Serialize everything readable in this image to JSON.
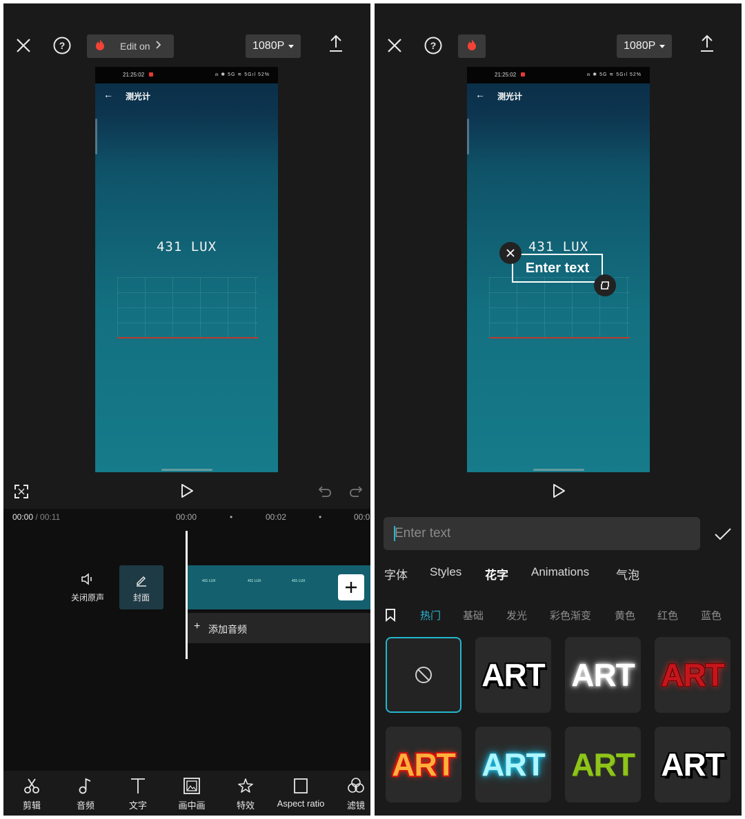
{
  "left": {
    "top": {
      "edit_label": "Edit on",
      "resolution": "1080P"
    },
    "phone": {
      "time": "21:25:02",
      "status_icons": "⍾ ✱ 5G ≋ 5Gıl 52%",
      "title": "测光计",
      "reading": "431 LUX"
    },
    "timeline": {
      "current": "00:00",
      "total": "/ 00:11",
      "tick_0": "00:00",
      "tick_2": "00:02",
      "tick_4": "00:0"
    },
    "clip_labels": [
      "431 LUX",
      "431 LUX",
      "431 LUX"
    ],
    "mute_label": "关闭原声",
    "cover_label": "封面",
    "add_audio_label": "添加音频",
    "tools": [
      "剪辑",
      "音频",
      "文字",
      "画中画",
      "特效",
      "Aspect ratio",
      "滤镜"
    ]
  },
  "right": {
    "top": {
      "resolution": "1080P"
    },
    "phone": {
      "time": "21:25:02",
      "status_icons": "⍾ ✱ 5G ≋ 5Gıl 52%",
      "title": "测光计",
      "reading": "431 LUX"
    },
    "overlay_text": "Enter text",
    "input_placeholder": "Enter text",
    "tabs": [
      "字体",
      "Styles",
      "花字",
      "Animations",
      "气泡"
    ],
    "active_tab": "花字",
    "categories": [
      "热门",
      "基础",
      "发光",
      "彩色渐变",
      "黄色",
      "红色",
      "蓝色"
    ],
    "active_category": "热门",
    "art_tiles": [
      "ART",
      "ART",
      "ART",
      "ART",
      "ART",
      "ART",
      "ART"
    ],
    "colors": {
      "accent": "#22b8cf",
      "active_cat": "#2bb6d6"
    }
  }
}
